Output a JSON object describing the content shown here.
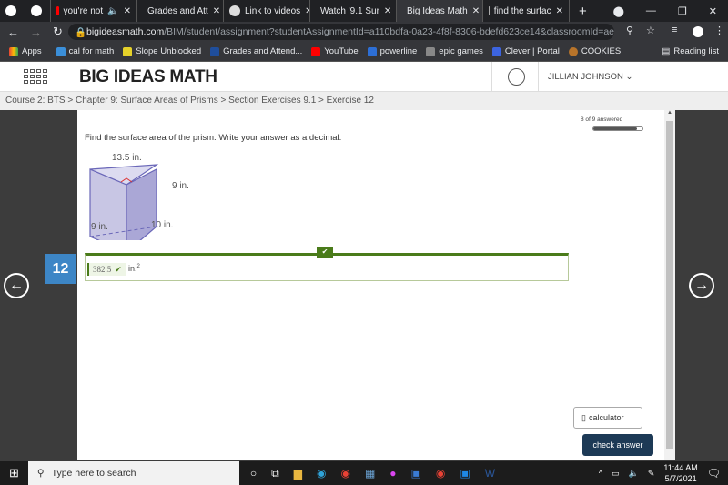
{
  "browser": {
    "tabs": [
      {
        "label": ""
      },
      {
        "label": ""
      },
      {
        "label": "you're not"
      },
      {
        "label": "Grades and Att"
      },
      {
        "label": "Link to videos"
      },
      {
        "label": "Watch '9.1 Sur"
      },
      {
        "label": "Big Ideas Math",
        "active": true
      },
      {
        "label": "find the surfac"
      }
    ],
    "url_host": "bigideasmath.com",
    "url_path": "/BIM/student/assignment?studentAssignmentId=a110bdfa-0a23-4f8f-8306-bdefd623ce14&classroomId=aef066de-ea2a-...",
    "bookmarks": [
      "Apps",
      "cal for math",
      "Slope Unblocked",
      "Grades and Attend...",
      "YouTube",
      "powerline",
      "epic games",
      "Clever | Portal",
      "COOKIES"
    ],
    "reading_list": "Reading list"
  },
  "header": {
    "logo": "BIG IDEAS MATH",
    "user": "JILLIAN JOHNSON"
  },
  "breadcrumb": "Course 2: BTS > Chapter 9: Surface Areas of Prisms > Section Exercises 9.1 > Exercise 12",
  "progress": {
    "label": "8 of 9 answered",
    "fraction": 0.89
  },
  "question": {
    "prompt": "Find the surface area of the prism. Write your answer as a decimal.",
    "number": "12",
    "labels": {
      "top": "13.5 in.",
      "height": "9 in.",
      "left": "9 in.",
      "bottom": "10 in."
    },
    "answer": "382.5",
    "unit": "in.",
    "exp": "2",
    "status": "correct"
  },
  "buttons": {
    "calculator": "calculator",
    "check": "check answer"
  },
  "taskbar": {
    "search": "Type here to search",
    "time": "11:44 AM",
    "date": "5/7/2021"
  },
  "colors": {
    "accent_blue": "#3d86c6",
    "correct_green": "#4a7b1a",
    "check_button": "#1d3a56"
  }
}
